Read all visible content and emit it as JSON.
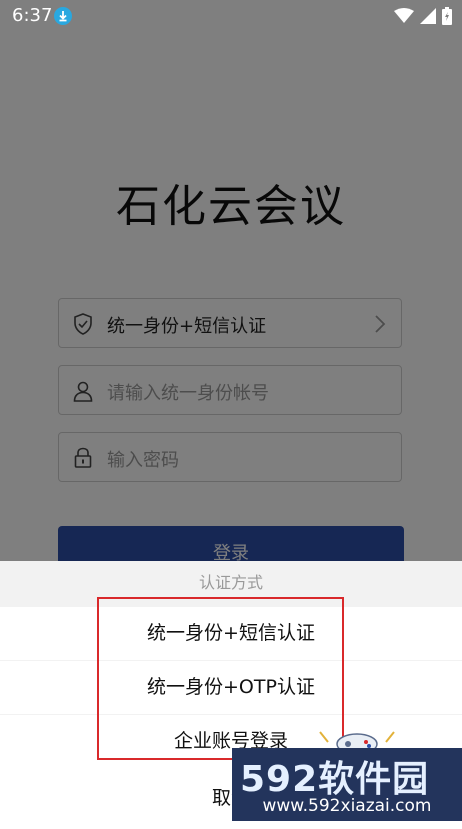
{
  "status_bar": {
    "time": "6:37",
    "icons": [
      "download-icon",
      "wifi-icon",
      "signal-icon",
      "battery-icon"
    ]
  },
  "login": {
    "app_title": "石化云会议",
    "auth_method_label": "统一身份+短信认证",
    "account_placeholder": "请输入统一身份帐号",
    "password_placeholder": "输入密码",
    "login_button": "登录"
  },
  "sheet": {
    "title": "认证方式",
    "options": [
      "统一身份+短信认证",
      "统一身份+OTP认证",
      "企业账号登录"
    ],
    "cancel": "取消"
  },
  "watermark": {
    "brand": "592软件园",
    "url": "www.592xiazai.com"
  },
  "colors": {
    "primary": "#2c4fa8",
    "highlight": "#d9292b",
    "overlay": "rgba(0,0,0,0.5)"
  }
}
